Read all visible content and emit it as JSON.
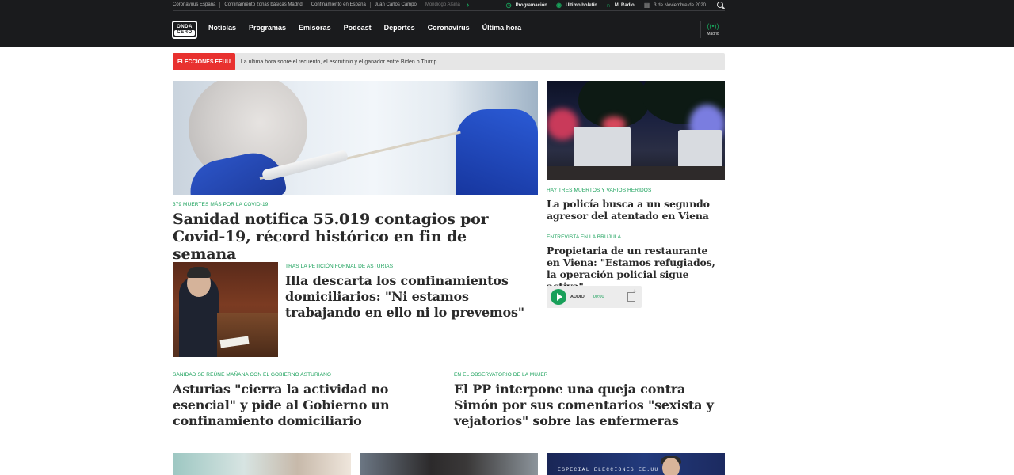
{
  "topbar": {
    "links": [
      "Coronavirus España",
      "Confinamiento zonas básicas Madrid",
      "Confinamiento en España",
      "Juan Carlos Campo",
      "Mondiogo Alsina"
    ],
    "programacion": "Programación",
    "ultimo_boletin": "Último boletín",
    "mi_radio": "Mi Radio",
    "date": "3 de Noviembre de 2020"
  },
  "logo": {
    "line1": "ONDA",
    "line2": "CERO"
  },
  "nav": [
    "Noticias",
    "Programas",
    "Emisoras",
    "Podcast",
    "Deportes",
    "Coronavirus",
    "Última hora"
  ],
  "radio": {
    "label": "Madrid"
  },
  "ticker": {
    "badge": "ELECCIONES EEUU",
    "text": "La última hora sobre el recuento, el escrutinio y el ganador entre Biden o Trump"
  },
  "articles": {
    "main": {
      "kicker": "379 MUERTES MÁS POR LA COVID-19",
      "headline": "Sanidad notifica 55.019 contagios por Covid-19, récord histórico en fin de semana"
    },
    "illa": {
      "kicker": "TRAS LA PETICIÓN FORMAL DE ASTURIAS",
      "headline": "Illa descarta los confinamientos domiciliarios: \"Ni estamos trabajando en ello ni lo prevemos\""
    },
    "viena1": {
      "kicker": "HAY TRES MUERTOS Y VARIOS HERIDOS",
      "headline": "La policía busca a un segundo agresor del atentado en Viena"
    },
    "viena2": {
      "kicker": "ENTREVISTA EN LA BRÚJULA",
      "headline": "Propietaria de un restaurante en Viena: \"Estamos refugiados, la operación policial sigue activa\""
    },
    "asturias": {
      "kicker": "SANIDAD SE REÚNE MAÑANA CON EL GOBIERNO ASTURIANO",
      "headline": "Asturias \"cierra la actividad no esencial\" y pide al Gobierno un confinamiento domiciliario"
    },
    "pp": {
      "kicker": "EN EL OBSERVATORIO DE LA MUJER",
      "headline": "El PP interpone una queja contra Simón por sus comentarios \"sexista y vejatorios\" sobre las enfermeras"
    }
  },
  "audio": {
    "label": "AUDIO",
    "time": "00:00"
  },
  "bottom": {
    "special_caption": "ESPECIAL ELECCIONES EE.UU"
  },
  "colors": {
    "accent": "#19a05a",
    "header": "#1a1b1d",
    "badge": "#e8312f"
  }
}
